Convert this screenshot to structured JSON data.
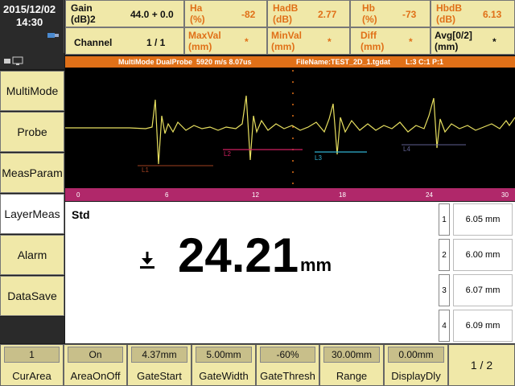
{
  "clock": {
    "date": "2015/12/02",
    "time": "14:30"
  },
  "params": {
    "gain": {
      "label": "Gain\n(dB)2",
      "value": "44.0 + 0.0"
    },
    "ha": {
      "label": "Ha\n(%)",
      "value": "-82"
    },
    "hadb": {
      "label": "HadB\n(dB)",
      "value": "2.77"
    },
    "hb": {
      "label": "Hb\n(%)",
      "value": "-73"
    },
    "hbdb": {
      "label": "HbdB\n(dB)",
      "value": "6.13"
    },
    "channel": {
      "label": "Channel",
      "value": "1 / 1"
    },
    "maxval": {
      "label": "MaxVal\n(mm)",
      "value": "*"
    },
    "minval": {
      "label": "MinVal\n(mm)",
      "value": "*"
    },
    "diff": {
      "label": "Diff\n(mm)",
      "value": "*"
    },
    "avg": {
      "label": "Avg[0/2]\n(mm)",
      "value": "*"
    }
  },
  "menu": [
    "MultiMode",
    "Probe",
    "MeasParam",
    "LayerMeas",
    "Alarm",
    "DataSave"
  ],
  "status": {
    "mode": "MultiMode  DualProbe",
    "velocity": "5920  m/s  8.07us",
    "file": "FileName:TEST_2D_1.tgdat",
    "layer": "L:3  C:1  P:1"
  },
  "cursors": [
    "L1",
    "L2",
    "L3",
    "L4"
  ],
  "ruler_labels": [
    "0",
    "6",
    "12",
    "18",
    "24",
    "30"
  ],
  "measure": {
    "label": "Std",
    "value": "24.21",
    "unit": "mm"
  },
  "layers": [
    {
      "n": "1",
      "v": "6.05 mm"
    },
    {
      "n": "2",
      "v": "6.00 mm"
    },
    {
      "n": "3",
      "v": "6.07 mm"
    },
    {
      "n": "4",
      "v": "6.09 mm"
    }
  ],
  "bottom": [
    {
      "val": "1",
      "label": "CurArea"
    },
    {
      "val": "On",
      "label": "AreaOnOff"
    },
    {
      "val": "4.37mm",
      "label": "GateStart"
    },
    {
      "val": "5.00mm",
      "label": "GateWidth"
    },
    {
      "val": "-60%",
      "label": "GateThresh"
    },
    {
      "val": "30.00mm",
      "label": "Range"
    },
    {
      "val": "0.00mm",
      "label": "DisplayDly"
    }
  ],
  "page": "1 / 2",
  "colors": {
    "panel": "#f0e8a8",
    "accent": "#e07018",
    "trace": "#e8e060",
    "ruler": "#b0286a"
  }
}
